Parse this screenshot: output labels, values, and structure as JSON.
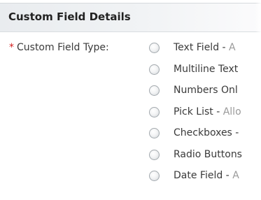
{
  "section": {
    "title": "Custom Field Details"
  },
  "custom_field_type": {
    "required_marker": "*",
    "label": "Custom Field Type:",
    "options": [
      {
        "name": "Text Field",
        "separator": " - ",
        "desc": "A"
      },
      {
        "name": "Multiline Text",
        "separator": "",
        "desc": ""
      },
      {
        "name": "Numbers Onl",
        "separator": "",
        "desc": ""
      },
      {
        "name": "Pick List",
        "separator": " - ",
        "desc": "Allo"
      },
      {
        "name": "Checkboxes",
        "separator": " -",
        "desc": ""
      },
      {
        "name": "Radio Buttons",
        "separator": "",
        "desc": ""
      },
      {
        "name": "Date Field",
        "separator": " - ",
        "desc": "A"
      }
    ]
  }
}
